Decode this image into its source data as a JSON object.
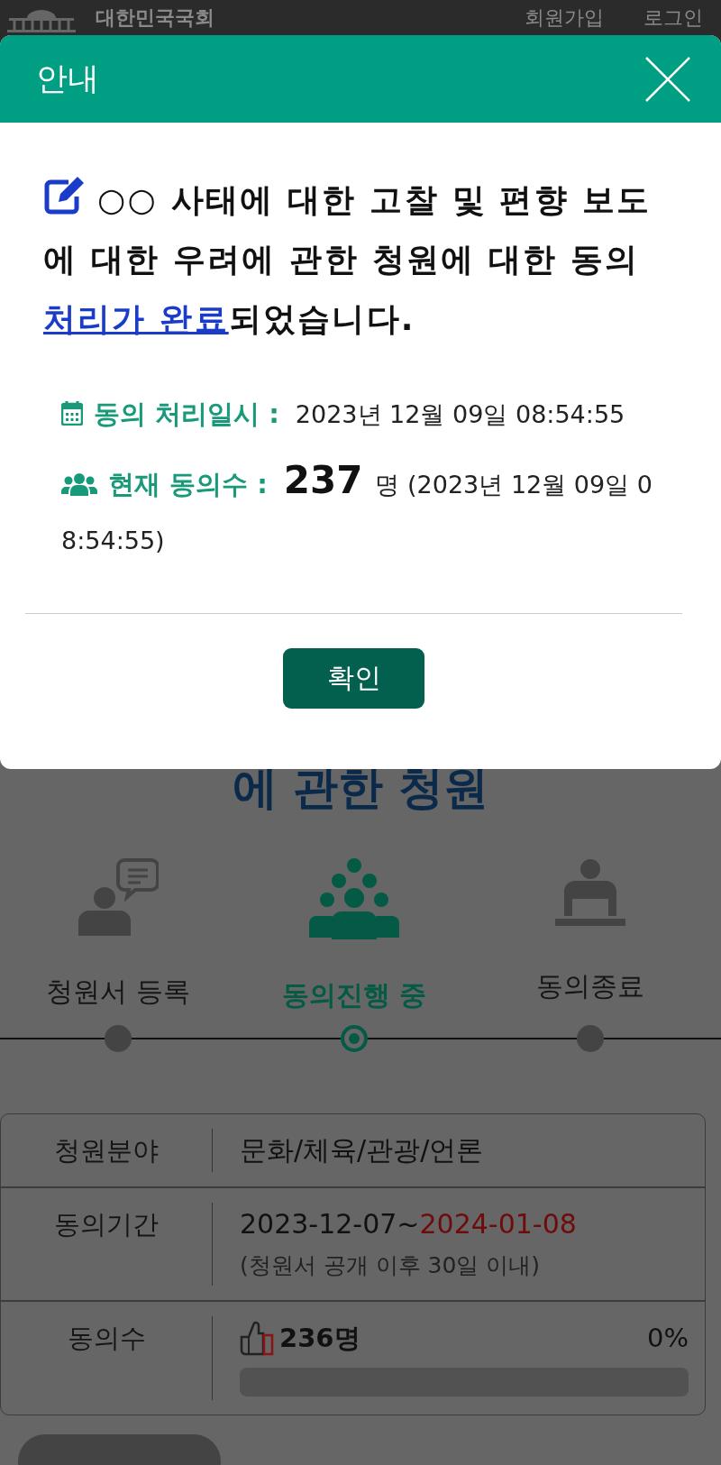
{
  "header": {
    "logo_text": "대한민국국회",
    "links": [
      {
        "label": "회원가입"
      },
      {
        "label": "로그인"
      }
    ]
  },
  "dialog": {
    "title": "안내",
    "message": {
      "text_before": "○○ 사태에 대한 고찰 및 편향 보도에 대한 우려에 관한 청원에 대한 동의 ",
      "link": "처리가 완료",
      "text_after": "되었습니다."
    },
    "details": [
      {
        "kind": "time",
        "label": "동의 처리일시 :",
        "value": "2023년 12월 09일 08:54:55"
      },
      {
        "kind": "count",
        "label": "현재 동의수 :",
        "count": "237",
        "value": "명 (2023년 12월 09일 08:54:55)"
      }
    ],
    "confirm_button": "확인"
  },
  "page_title": "에 관한 청원",
  "steps": [
    {
      "label": "청원서 등록",
      "current": false
    },
    {
      "label": "동의진행 중",
      "current": true
    },
    {
      "label": "동의종료",
      "current": false
    }
  ],
  "info_table": [
    {
      "kind": "text",
      "label": "청원분야",
      "value": "문화/체육/관광/언론"
    },
    {
      "kind": "period",
      "label": "동의기간",
      "start": "2023-12-07~",
      "end": "2024-01-08",
      "note": "(청원서 공개 이후 30일 이내)"
    },
    {
      "kind": "progress",
      "label": "동의수",
      "count": "236명",
      "percent": "0%",
      "level": 0
    }
  ]
}
